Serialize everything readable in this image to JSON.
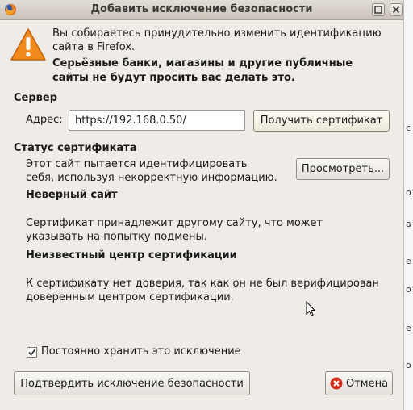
{
  "window": {
    "title": "Добавить исключение безопасности",
    "app_icon": "firefox-icon",
    "controls": [
      "maximize-icon",
      "close-icon"
    ]
  },
  "warning": {
    "icon": "warning-triangle-icon",
    "line1": "Вы собираетесь принудительно изменить идентификацию",
    "line2": "сайта в Firefox.",
    "bold_line1": "Серьёзные банки, магазины и другие публичные",
    "bold_line2": "сайты не будут просить вас делать это."
  },
  "server": {
    "heading": "Сервер",
    "address_label": "Адрес:",
    "address_value": "https://192.168.0.50/",
    "get_cert_button": "Получить сертификат"
  },
  "status": {
    "heading": "Статус сертификата",
    "desc_line1": "Этот сайт пытается идентифицировать",
    "desc_line2": "себя, используя некорректную информацию.",
    "view_button": "Просмотреть...",
    "wrong_site_heading": "Неверный сайт",
    "wrong_site_line1": "Сертификат принадлежит другому сайту, что может",
    "wrong_site_line2": "указывать на попытку подмены.",
    "unknown_ca_heading": "Неизвестный центр сертификации",
    "unknown_ca_line1": "К сертификату нет доверия, так как он не был верифицирован",
    "unknown_ca_line2": "доверенным центром сертификации."
  },
  "permanent": {
    "checked": true,
    "label": "Постоянно хранить это исключение"
  },
  "actions": {
    "confirm_button": "Подтвердить исключение безопасности",
    "cancel_button": "Отмена",
    "cancel_icon": "cancel-x-icon"
  },
  "background_window": {
    "visible_chars": [
      "c",
      "o",
      "a",
      "e",
      "o",
      "e",
      "o"
    ]
  },
  "colors": {
    "dialog_bg": "#efebe7",
    "warning_orange": "#f08a1c",
    "cancel_red": "#d42a1c"
  }
}
